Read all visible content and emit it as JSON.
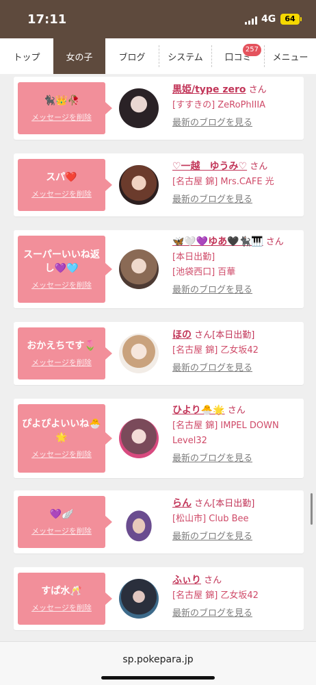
{
  "status": {
    "time": "17:11",
    "network": "4G",
    "battery": "64"
  },
  "nav": {
    "tabs": [
      {
        "label": "トップ",
        "active": false
      },
      {
        "label": "女の子",
        "active": true
      },
      {
        "label": "ブログ",
        "active": false
      },
      {
        "label": "システム",
        "active": false
      },
      {
        "label": "口コミ",
        "active": false,
        "badge": "257"
      },
      {
        "label": "メニュー",
        "active": false
      }
    ]
  },
  "items": [
    {
      "message": "🐈‍⬛👑🥀",
      "delete_label": "メッセージを削除",
      "name": "黒姫/type zero",
      "san": "さん",
      "line2": "[すすきの] ZeRoPhIIIA",
      "line3": "",
      "blog": "最新のブログを見る"
    },
    {
      "message": "スパ❤️",
      "delete_label": "メッセージを削除",
      "name": "♡一越　ゆうみ♡",
      "san": "さん",
      "line2": "[名古屋 錦] Mrs.CAFE 光",
      "line3": "",
      "blog": "最新のブログを見る"
    },
    {
      "message": "スーパーいいね返し💜🩵",
      "delete_label": "メッセージを削除",
      "name": "🦋🤍💜ゆあ🖤🐈‍⬛🎹",
      "san": "さん",
      "line2": "[本日出勤]",
      "line3": "[池袋西口] 百華",
      "blog": "最新のブログを見る"
    },
    {
      "message": "おかえちです🌷",
      "delete_label": "メッセージを削除",
      "name": "ほの",
      "san": "さん[本日出勤]",
      "line2": "[名古屋 錦] 乙女坂42",
      "line3": "",
      "blog": "最新のブログを見る"
    },
    {
      "message": "ぴよぴよいいね🐣🌟",
      "delete_label": "メッセージを削除",
      "name": "ひより🐣🌟",
      "san": "さん",
      "line2": "[名古屋 錦] IMPEL DOWN",
      "line3": "Level32",
      "blog": "最新のブログを見る"
    },
    {
      "message": "💜🪽",
      "delete_label": "メッセージを削除",
      "name": "らん",
      "san": "さん[本日出勤]",
      "line2": "[松山市] Club Bee",
      "line3": "",
      "blog": "最新のブログを見る"
    },
    {
      "message": "すぱ水🥂",
      "delete_label": "メッセージを削除",
      "name": "ふぃり",
      "san": "さん",
      "line2": "[名古屋 錦] 乙女坂42",
      "line3": "",
      "blog": "最新のブログを見る"
    }
  ],
  "urlbar": {
    "url": "sp.pokepara.jp"
  },
  "colors": {
    "header": "#5e4a3d",
    "bubble": "#f28f9a",
    "name": "#c23659",
    "badge": "#e4535d"
  }
}
